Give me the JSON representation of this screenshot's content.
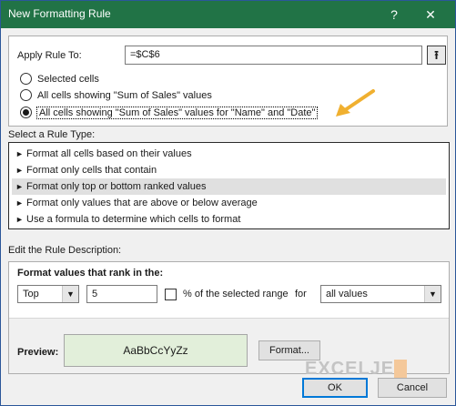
{
  "title": "New Formatting Rule",
  "titlebar": {
    "help_label": "?",
    "close_label": "✕"
  },
  "apply": {
    "label": "Apply Rule To:",
    "value": "=$C$6",
    "collapse_glyph": "⭱",
    "options": [
      {
        "label": "Selected cells",
        "checked": false
      },
      {
        "label": "All cells showing \"Sum of Sales\" values",
        "checked": false
      },
      {
        "label": "All cells showing \"Sum of Sales\" values for \"Name\" and \"Date\"",
        "checked": true
      }
    ]
  },
  "annotation": {
    "arrow_color": "#f0b030"
  },
  "rule_type": {
    "label": "Select a Rule Type:",
    "items": [
      "Format all cells based on their values",
      "Format only cells that contain",
      "Format only top or bottom ranked values",
      "Format only values that are above or below average",
      "Use a formula to determine which cells to format"
    ],
    "selected_index": 2
  },
  "description": {
    "label": "Edit the Rule Description:",
    "heading": "Format values that rank in the:",
    "rank_select": "Top",
    "rank_value": "5",
    "percent_label": "% of the selected range",
    "for_label": "for",
    "scope_select": "all values"
  },
  "preview": {
    "label": "Preview:",
    "sample": "AaBbCcYyZz",
    "fill_color": "#e2efda",
    "format_button": "Format..."
  },
  "buttons": {
    "ok": "OK",
    "cancel": "Cancel"
  },
  "watermark": "EXCELJET",
  "colors": {
    "titlebar": "#217346",
    "ok_border": "#0078d7"
  }
}
